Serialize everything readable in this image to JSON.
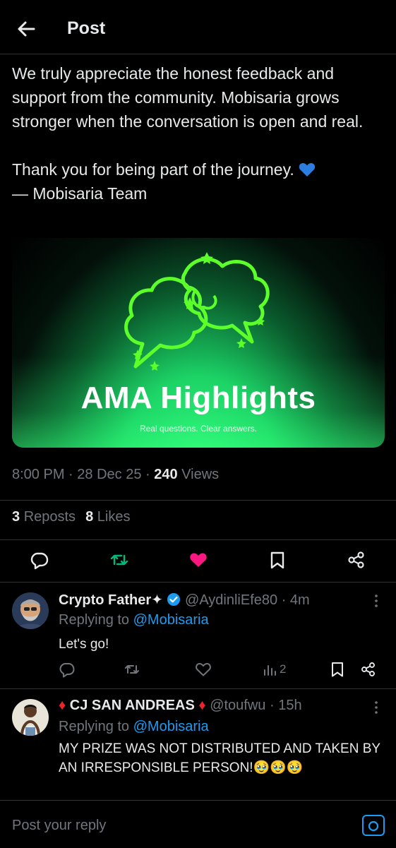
{
  "header": {
    "title": "Post"
  },
  "post": {
    "text": "We truly appreciate the honest feedback and support from the community. Mobisaria grows stronger when the conversation is open and real.\n\nThank you for being part of the journey.",
    "signature": "— Mobisaria Team",
    "media": {
      "title": "AMA Highlights",
      "subtitle": "Real questions. Clear answers."
    },
    "time": "8:00 PM",
    "date": "28 Dec 25",
    "views_count": "240",
    "views_label": "Views",
    "reposts_count": "3",
    "reposts_label": "Reposts",
    "likes_count": "8",
    "likes_label": "Likes"
  },
  "colors": {
    "accent": "#1d9bf0",
    "repost_green": "#00ba7c",
    "like_pink": "#f91880"
  },
  "replies": [
    {
      "name": "Crypto Father",
      "name_suffix": "✦",
      "handle": "@AydinliEfe80",
      "time": "4m",
      "replying_label": "Replying to",
      "mention": "@Mobisaria",
      "body": "Let's go!",
      "views": "2"
    },
    {
      "name_prefix": "♦",
      "name": "CJ SAN ANDREAS",
      "name_suffix": "♦",
      "handle": "@toufwu",
      "time": "15h",
      "replying_label": "Replying to",
      "mention": "@Mobisaria",
      "body": "MY PRIZE WAS NOT DISTRIBUTED AND TAKEN BY AN IRRESPONSIBLE PERSON!🥹🥹🥹"
    }
  ],
  "compose": {
    "placeholder": "Post your reply"
  }
}
